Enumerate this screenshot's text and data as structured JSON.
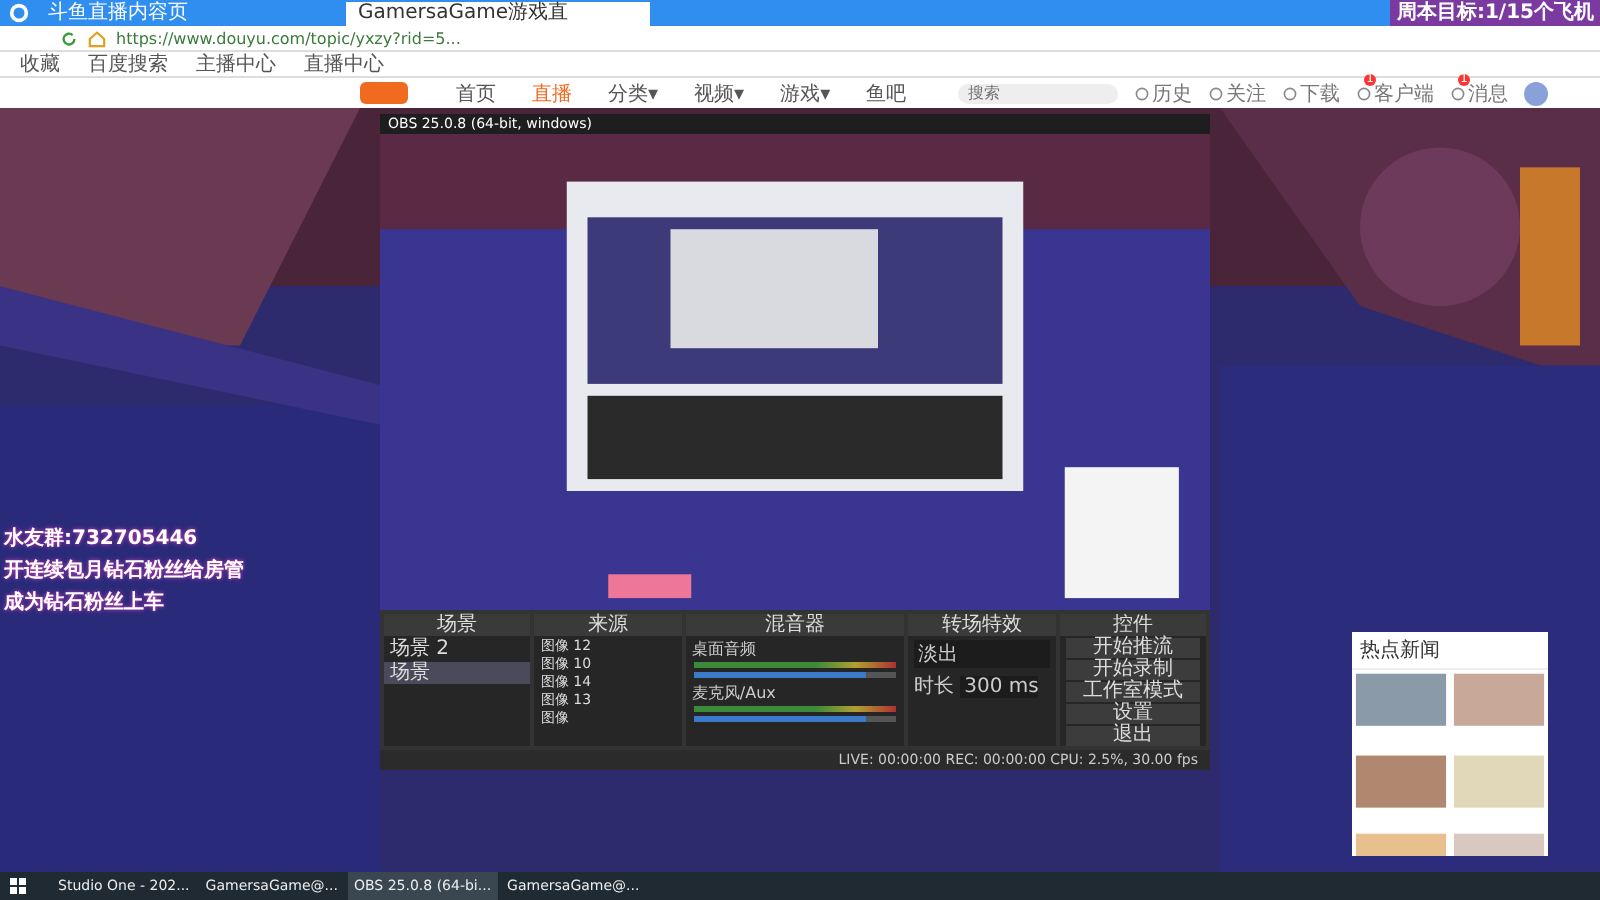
{
  "browser": {
    "tabs": [
      {
        "label": "斗鱼直播内容页",
        "selected": false
      },
      {
        "label": "GamersaGame游戏直",
        "selected": true
      }
    ],
    "url": "https://www.douyu.com/topic/yxzy?rid=5...",
    "bookmarks": [
      "收藏",
      "百度搜索",
      "主播中心",
      "直播中心"
    ]
  },
  "site": {
    "nav": [
      {
        "label": "首页",
        "selected": false
      },
      {
        "label": "直播",
        "selected": true
      },
      {
        "label": "分类▾",
        "selected": false
      },
      {
        "label": "视频▾",
        "selected": false
      },
      {
        "label": "游戏▾",
        "selected": false
      },
      {
        "label": "鱼吧",
        "selected": false
      }
    ],
    "search": {
      "placeholder": "搜索"
    },
    "icons": [
      {
        "label": "历史"
      },
      {
        "label": "关注"
      },
      {
        "label": "下载"
      },
      {
        "label": "客户端",
        "badge": "1"
      },
      {
        "label": "消息",
        "badge": "1"
      }
    ]
  },
  "overlay": {
    "goal": "周本目标:1/15个飞机",
    "lines": [
      "水友群:732705446",
      "开连续包月钻石粉丝给房管",
      "成为钻石粉丝上车"
    ]
  },
  "obs": {
    "title": "OBS 25.0.8 (64-bit, windows)",
    "scenes": {
      "title": "场景",
      "items": [
        {
          "label": "场景 2",
          "selected": false
        },
        {
          "label": "场景",
          "selected": true
        }
      ]
    },
    "sources": {
      "title": "来源",
      "items": [
        "图像 12",
        "图像 10",
        "图像 14",
        "图像 13",
        "图像"
      ]
    },
    "mixer": {
      "title": "混音器",
      "channels": [
        {
          "name": "桌面音频",
          "level": 0.85
        },
        {
          "name": "麦克风/Aux",
          "level": 0.85
        }
      ]
    },
    "transitions": {
      "title": "转场特效",
      "value": "淡出",
      "duration_label": "时长",
      "duration": "300 ms"
    },
    "controls": {
      "title": "控件",
      "buttons": [
        "开始推流",
        "开始录制",
        "工作室模式",
        "设置",
        "退出"
      ]
    },
    "status": "LIVE: 00:00:00   REC: 00:00:00   CPU: 2.5%, 30.00 fps"
  },
  "ad": {
    "title": "热点新闻"
  },
  "taskbar": {
    "apps": [
      {
        "label": "Studio One - 202...",
        "selected": false
      },
      {
        "label": "GamersaGame@...",
        "selected": false
      },
      {
        "label": "OBS 25.0.8 (64-bi...",
        "selected": true
      },
      {
        "label": "GamersaGame@...",
        "selected": false
      }
    ]
  }
}
